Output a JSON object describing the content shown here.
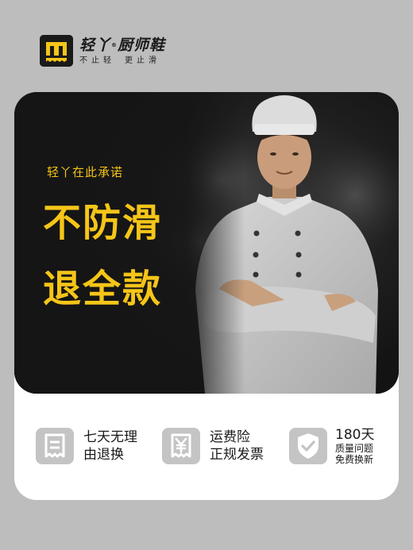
{
  "brand": {
    "name": "轻丫",
    "reg_mark": "®",
    "name_suffix": "厨师鞋",
    "slogan_left": "不止轻",
    "slogan_right": "更止滑",
    "logo_icon": "brand-logo-icon"
  },
  "hero": {
    "promise": "轻丫在此承诺",
    "headline_line1": "不防滑",
    "headline_line2": "退全款"
  },
  "features": [
    {
      "icon": "receipt-icon",
      "line1": "七天无理",
      "line2": "由退换"
    },
    {
      "icon": "invoice-yen-icon",
      "line1": "运费险",
      "line2": "正规发票"
    },
    {
      "icon": "shield-check-icon",
      "line1": "180天",
      "line2": "质量问题",
      "line3": "免费换新"
    }
  ],
  "colors": {
    "accent": "#f5c518",
    "background": "#bdbdbd",
    "hero": "#151515",
    "icon_bg": "#c4c4c4"
  }
}
